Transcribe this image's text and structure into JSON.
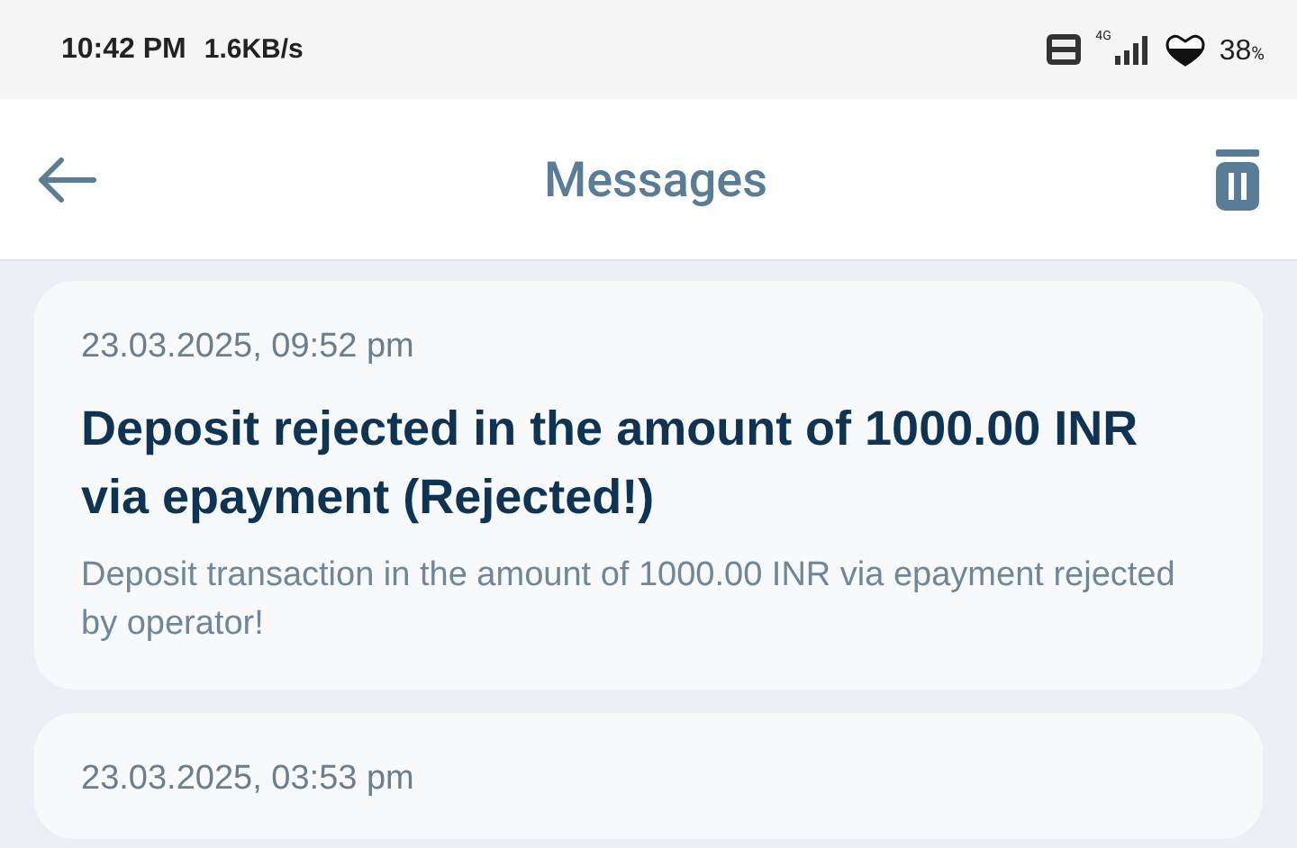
{
  "status_bar": {
    "time": "10:42 PM",
    "speed": "1.6KB/s",
    "network": "4G",
    "battery": "38",
    "battery_unit": "%"
  },
  "header": {
    "title": "Messages"
  },
  "messages": [
    {
      "date": "23.03.2025, 09:52 pm",
      "title": "Deposit rejected in the amount of 1000.00 INR via epayment (Rejected!)",
      "body": "Deposit transaction in the amount of 1000.00 INR via epayment rejected by operator!"
    },
    {
      "date": "23.03.2025, 03:53 pm"
    }
  ]
}
